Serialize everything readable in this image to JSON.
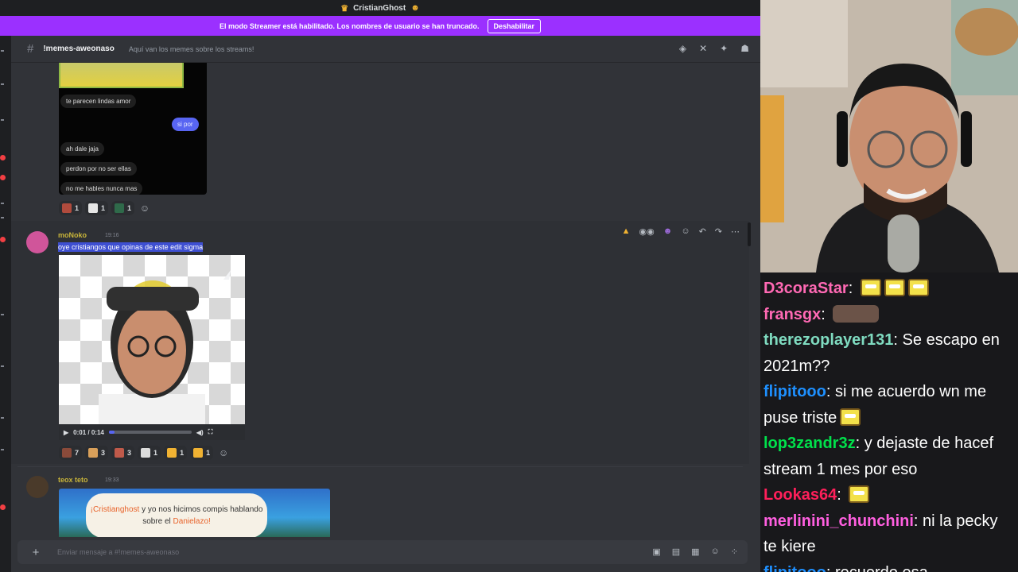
{
  "discord": {
    "window_title": "CristianGhost",
    "streamer_notice": "El modo Streamer está habilitado. Los nombres de usuario se han truncado.",
    "disable_button": "Deshabilitar",
    "channel": {
      "name": "!memes-aweonaso",
      "topic": "Aquí van los memes sobre los streams!"
    },
    "screenshot_bubbles": [
      {
        "text": "te parecen lindas amor",
        "from": "other"
      },
      {
        "text": "si por",
        "from": "me"
      },
      {
        "text": "ah dale jaja",
        "from": "other"
      },
      {
        "text": "perdon por no ser ellas",
        "from": "other"
      },
      {
        "text": "no me hables nunca mas",
        "from": "other"
      }
    ],
    "reactions_1": [
      {
        "count": "1",
        "color": "#b04b3d"
      },
      {
        "count": "1",
        "color": "#e6e6e6"
      },
      {
        "count": "1",
        "color": "#2f6a4a"
      }
    ],
    "message_2": {
      "username": "moNoko",
      "time": "19:16",
      "text": "oye cristiangos que opinas de este edit sigma",
      "video_time": "0:01 / 0:14",
      "video_progress": 0.07,
      "reactions": [
        {
          "count": "7",
          "color": "#8a4a3a"
        },
        {
          "count": "3",
          "color": "#d9a05a"
        },
        {
          "count": "3",
          "color": "#c05a4a"
        },
        {
          "count": "1",
          "color": "#dcdcdc"
        },
        {
          "count": "1",
          "color": "#f0b232"
        },
        {
          "count": "1",
          "color": "#f0b232"
        }
      ]
    },
    "message_3": {
      "username": "teox teto",
      "time": "19:33",
      "banner_prefix": "¡Cristianghost",
      "banner_middle": " y yo nos hicimos compis hablando sobre el ",
      "banner_suffix": "Danielazo!"
    },
    "composer_placeholder": "Enviar mensaje a #!memes-aweonaso"
  },
  "chat": {
    "messages": [
      {
        "user": "D3coraStar",
        "color": "#ff69b4",
        "text": "",
        "emotes": "sponge3"
      },
      {
        "user": "fransgx",
        "color": "#ff69b4",
        "text": "",
        "emotes": "dark"
      },
      {
        "user": "therezoplayer131",
        "color": "#7fdbc0",
        "text": "Se escapo en 2021m??",
        "emotes": ""
      },
      {
        "user": "flipitooo",
        "color": "#1e90ff",
        "text": "si me acuerdo wn me puse triste",
        "emotes": "sponge1"
      },
      {
        "user": "lop3zandr3z",
        "color": "#00e14b",
        "text": "y dejaste de hacef stream 1 mes por eso",
        "emotes": ""
      },
      {
        "user": "Lookas64",
        "color": "#ff1f5a",
        "text": "",
        "emotes": "sponge1"
      },
      {
        "user": "merlinini_chunchini",
        "color": "#ff5fe0",
        "text": "ni la pecky te kiere",
        "emotes": ""
      },
      {
        "user": "flipitooo",
        "color": "#1e90ff",
        "text": "recuerdo esa",
        "emotes": ""
      }
    ]
  }
}
